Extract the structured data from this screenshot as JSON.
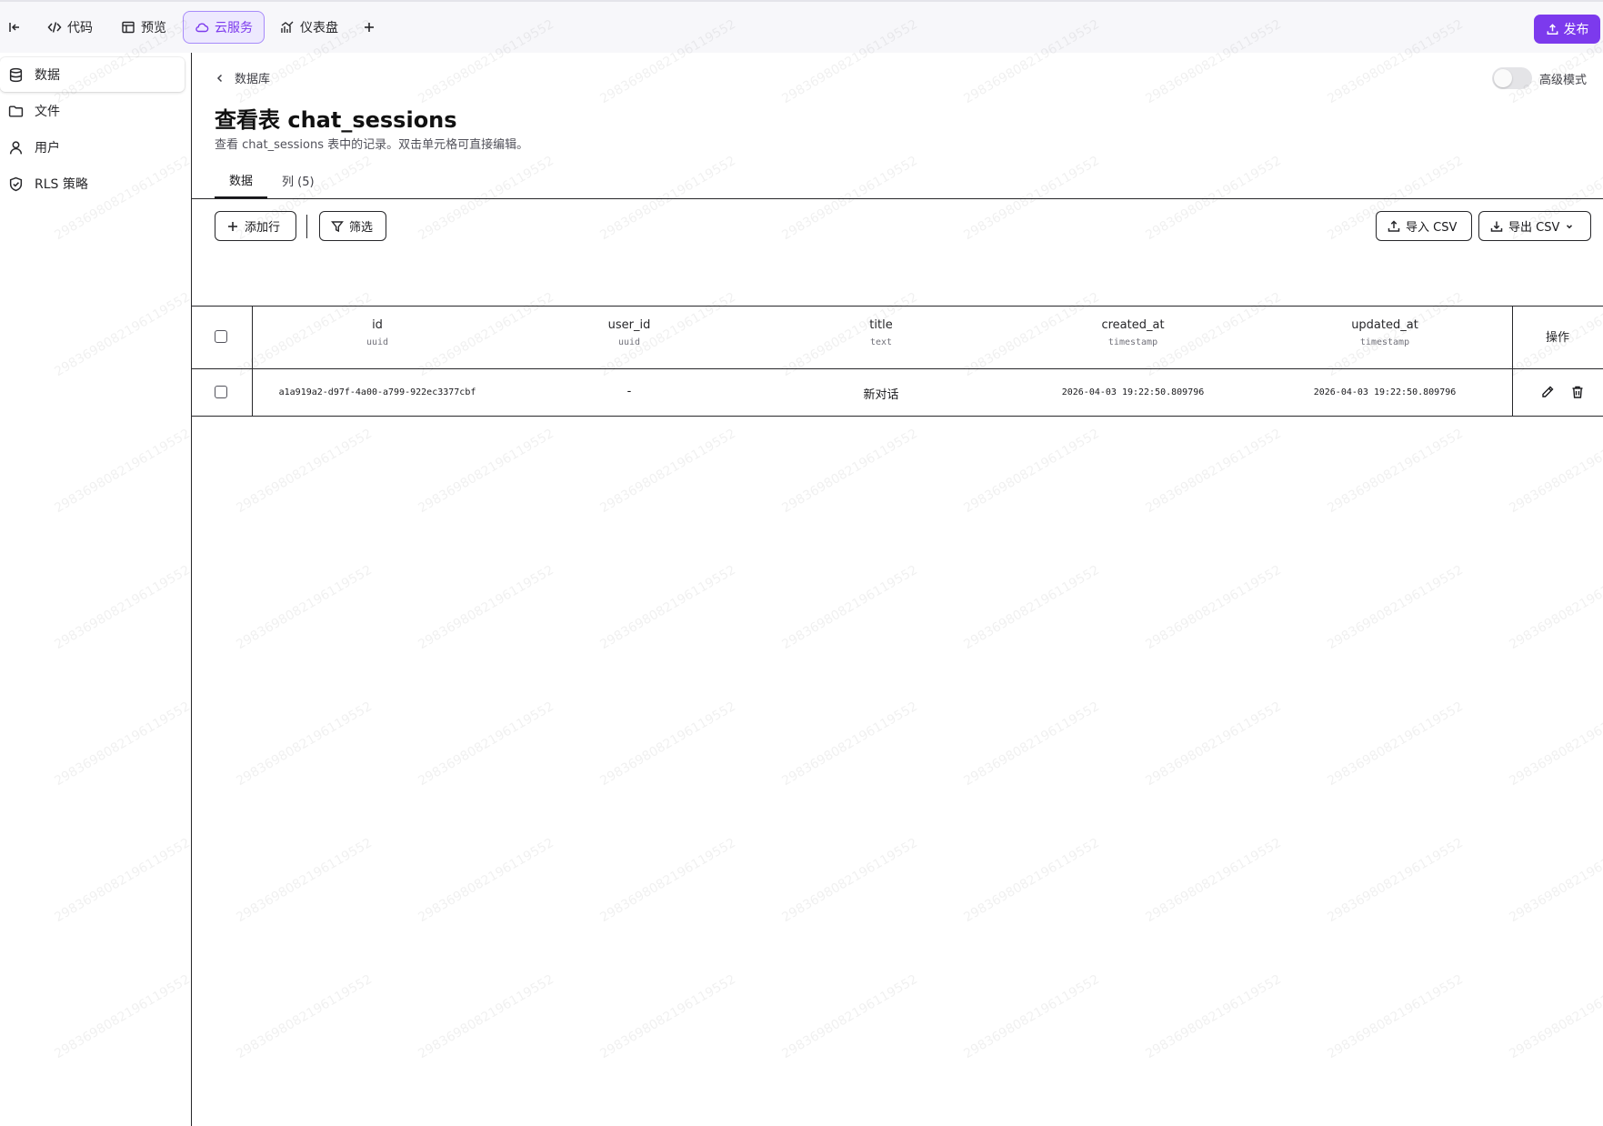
{
  "topbar": {
    "tabs": [
      {
        "label": "代码"
      },
      {
        "label": "预览"
      },
      {
        "label": "云服务"
      },
      {
        "label": "仪表盘"
      }
    ],
    "publish_label": "发布",
    "accent_color": "#7c3aed"
  },
  "sidebar": {
    "items": [
      {
        "label": "数据",
        "icon": "database-icon"
      },
      {
        "label": "文件",
        "icon": "folder-icon"
      },
      {
        "label": "用户",
        "icon": "user-icon"
      },
      {
        "label": "RLS 策略",
        "icon": "shield-icon"
      }
    ]
  },
  "main": {
    "breadcrumb": "数据库",
    "advanced_mode_label": "高级模式",
    "advanced_mode_on": false,
    "title": "查看表 chat_sessions",
    "description": "查看 chat_sessions 表中的记录。双击单元格可直接编辑。",
    "tabs": [
      {
        "label": "数据"
      },
      {
        "label": "列 (5)"
      }
    ],
    "toolbar": {
      "add_row_label": "添加行",
      "filter_label": "筛选",
      "import_label": "导入 CSV",
      "export_label": "导出 CSV"
    }
  },
  "table": {
    "columns": [
      {
        "name": "id",
        "type": "uuid"
      },
      {
        "name": "user_id",
        "type": "uuid"
      },
      {
        "name": "title",
        "type": "text"
      },
      {
        "name": "created_at",
        "type": "timestamp"
      },
      {
        "name": "updated_at",
        "type": "timestamp"
      }
    ],
    "ops_header": "操作",
    "rows": [
      {
        "id": "a1a919a2-d97f-4a00-a799-922ec3377cbf",
        "user_id": "-",
        "title": "新对话",
        "created_at": "2026-04-03 19:22:50.809796",
        "updated_at": "2026-04-03 19:22:50.809796"
      }
    ]
  },
  "watermark": "2983698082196119552"
}
